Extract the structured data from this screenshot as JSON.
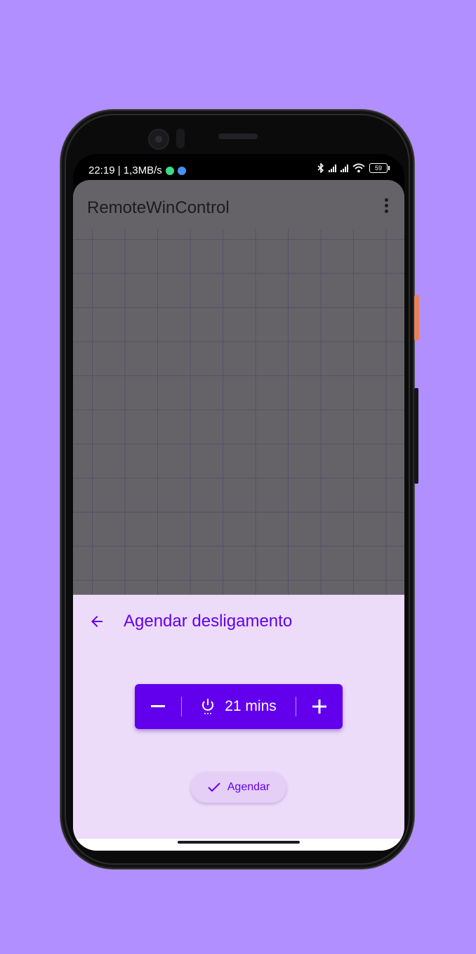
{
  "statusbar": {
    "time_speed": "22:19 | 1,3MB/s",
    "battery": "59"
  },
  "appbar": {
    "title": "RemoteWinControl",
    "more_icon": "more-vert-icon"
  },
  "sheet": {
    "title": "Agendar desligamento",
    "back_icon": "arrow-back-icon",
    "stepper": {
      "decrement_icon": "minus-icon",
      "increment_icon": "plus-icon",
      "timer_icon": "power-timer-icon",
      "value": "21 mins"
    },
    "schedule_button": {
      "icon": "check-icon",
      "label": "Agendar"
    }
  },
  "colors": {
    "background": "#b18ffe",
    "accent": "#6200ee",
    "sheet": "#ecdcfa",
    "scrim": "#656368"
  }
}
